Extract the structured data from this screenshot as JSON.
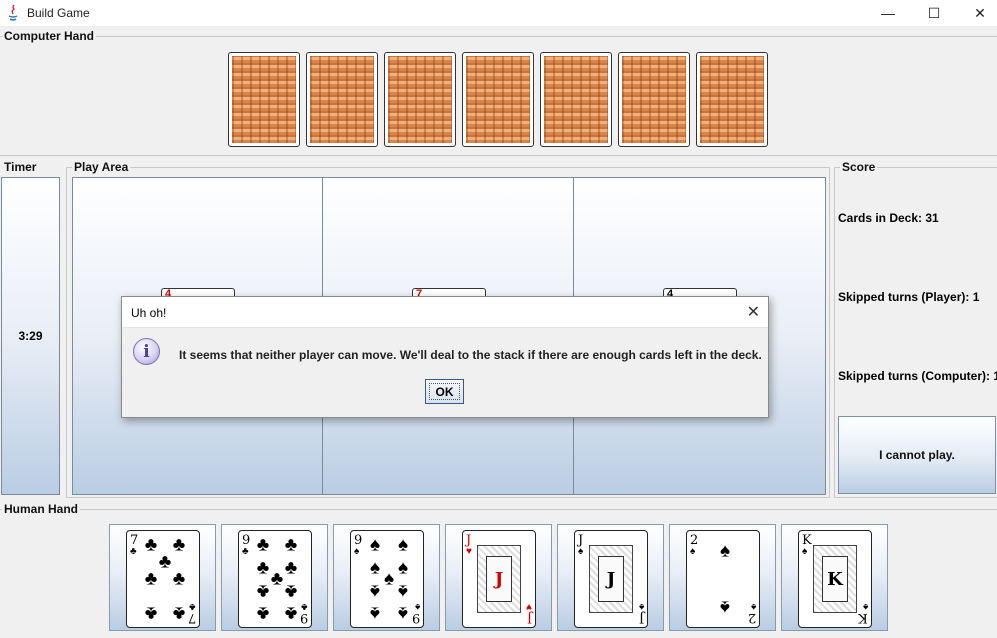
{
  "window": {
    "title": "Build Game",
    "minimize": "—",
    "maximize": "☐",
    "close": "✕"
  },
  "computer_hand": {
    "label": "Computer Hand",
    "card_count": 7
  },
  "timer": {
    "label": "Timer",
    "value": "3:29"
  },
  "play_area": {
    "label": "Play Area",
    "stacks": [
      {
        "top_rank": "4",
        "color": "#d40000"
      },
      {
        "top_rank": "7",
        "color": "#d40000"
      },
      {
        "top_rank": "4",
        "color": "#000000"
      }
    ]
  },
  "score": {
    "label": "Score",
    "cards_in_deck": "Cards in Deck: 31",
    "skipped_player": "Skipped turns (Player): 1",
    "skipped_computer": "Skipped turns (Computer): 1",
    "cannot_play_button": "I cannot play."
  },
  "human_hand": {
    "label": "Human Hand",
    "cards": [
      {
        "rank": "7",
        "suit": "♣",
        "color": "blk"
      },
      {
        "rank": "9",
        "suit": "♣",
        "color": "blk"
      },
      {
        "rank": "9",
        "suit": "♠",
        "color": "blk"
      },
      {
        "rank": "J",
        "suit": "♥",
        "color": "red"
      },
      {
        "rank": "J",
        "suit": "♠",
        "color": "blk"
      },
      {
        "rank": "2",
        "suit": "♠",
        "color": "blk"
      },
      {
        "rank": "K",
        "suit": "♠",
        "color": "blk"
      }
    ]
  },
  "dialog": {
    "title": "Uh oh!",
    "close": "✕",
    "icon": "i",
    "message": "It seems that neither player can move. We'll deal to the stack if there are enough cards left in the deck.",
    "ok_label": "OK"
  }
}
